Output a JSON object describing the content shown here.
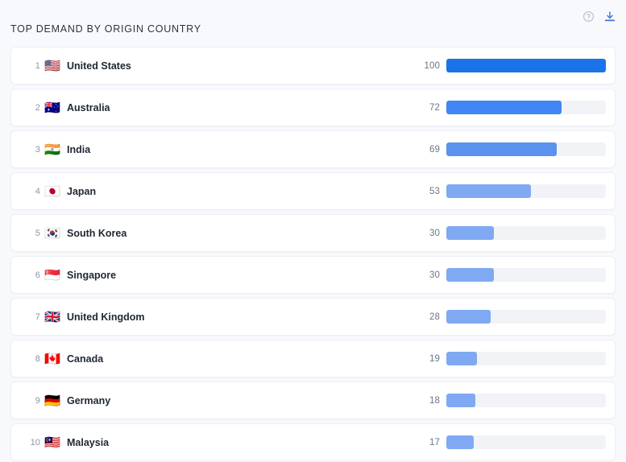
{
  "header": {
    "title": "TOP DEMAND BY ORIGIN COUNTRY",
    "help_icon": "help-circle-icon",
    "download_icon": "download-icon"
  },
  "colors": {
    "page_background": "#f7f9fc",
    "card_background": "#ffffff",
    "card_border": "#eceff4",
    "track": "#f1f3f6",
    "title_text": "#2e3440",
    "country_text": "#1f2733",
    "rank_text": "#8b95a5",
    "value_text": "#6b7685",
    "bar_rank1": "#1a73e8",
    "bar_rank2": "#4285f4",
    "bar_rank3": "#5b91ef",
    "bar_rest": "#7fa9f2",
    "download_icon": "#3f74d0",
    "help_icon": "#b8bfc9"
  },
  "chart_data": {
    "type": "bar",
    "title": "TOP DEMAND BY ORIGIN COUNTRY",
    "xlabel": "",
    "ylabel": "",
    "orientation": "horizontal",
    "xlim": [
      0,
      100
    ],
    "grid": false,
    "legend": null,
    "categories": [
      "United States",
      "Australia",
      "India",
      "Japan",
      "South Korea",
      "Singapore",
      "United Kingdom",
      "Canada",
      "Germany",
      "Malaysia"
    ],
    "values": [
      100,
      72,
      69,
      53,
      30,
      30,
      28,
      19,
      18,
      17
    ]
  },
  "rows": [
    {
      "rank": "1",
      "flag": "🇺🇸",
      "flag_name": "flag-united-states",
      "country": "United States",
      "value": "100",
      "pct": 100,
      "color": "#1a73e8"
    },
    {
      "rank": "2",
      "flag": "🇦🇺",
      "flag_name": "flag-australia",
      "country": "Australia",
      "value": "72",
      "pct": 72,
      "color": "#4285f4"
    },
    {
      "rank": "3",
      "flag": "🇮🇳",
      "flag_name": "flag-india",
      "country": "India",
      "value": "69",
      "pct": 69,
      "color": "#5b91ef"
    },
    {
      "rank": "4",
      "flag": "🇯🇵",
      "flag_name": "flag-japan",
      "country": "Japan",
      "value": "53",
      "pct": 53,
      "color": "#7fa9f2"
    },
    {
      "rank": "5",
      "flag": "🇰🇷",
      "flag_name": "flag-south-korea",
      "country": "South Korea",
      "value": "30",
      "pct": 30,
      "color": "#7fa9f2"
    },
    {
      "rank": "6",
      "flag": "🇸🇬",
      "flag_name": "flag-singapore",
      "country": "Singapore",
      "value": "30",
      "pct": 30,
      "color": "#7fa9f2"
    },
    {
      "rank": "7",
      "flag": "🇬🇧",
      "flag_name": "flag-united-kingdom",
      "country": "United Kingdom",
      "value": "28",
      "pct": 28,
      "color": "#7fa9f2"
    },
    {
      "rank": "8",
      "flag": "🇨🇦",
      "flag_name": "flag-canada",
      "country": "Canada",
      "value": "19",
      "pct": 19,
      "color": "#7fa9f2"
    },
    {
      "rank": "9",
      "flag": "🇩🇪",
      "flag_name": "flag-germany",
      "country": "Germany",
      "value": "18",
      "pct": 18,
      "color": "#7fa9f2"
    },
    {
      "rank": "10",
      "flag": "🇲🇾",
      "flag_name": "flag-malaysia",
      "country": "Malaysia",
      "value": "17",
      "pct": 17,
      "color": "#7fa9f2"
    }
  ]
}
